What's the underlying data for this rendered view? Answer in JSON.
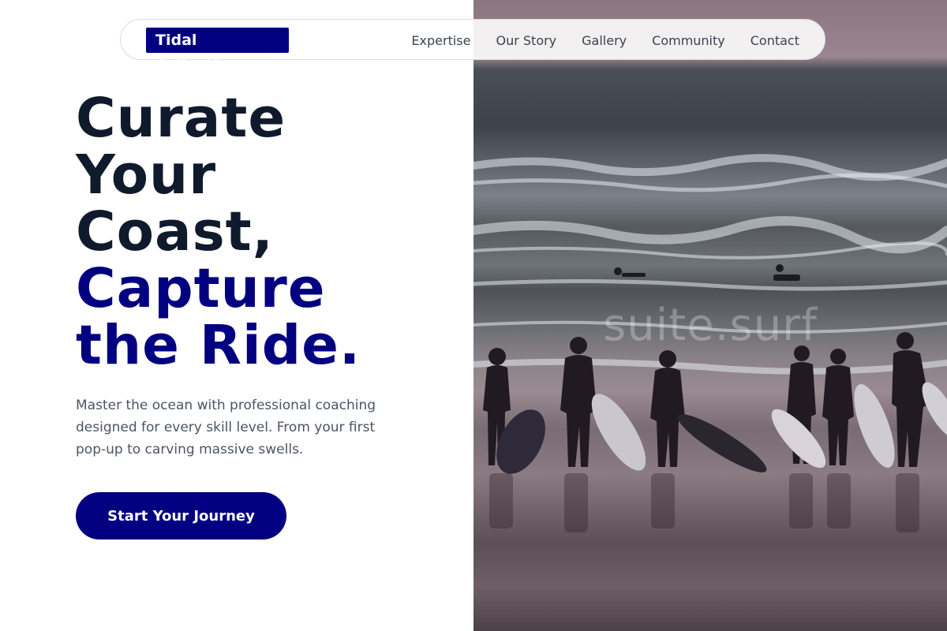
{
  "nav": {
    "brand": "Tidal Collective",
    "links": [
      "Expertise",
      "Our Story",
      "Gallery",
      "Community",
      "Contact"
    ]
  },
  "hero": {
    "headline_lines": [
      "Curate",
      "Your",
      "Coast,"
    ],
    "headline_accent_lines": [
      "Capture",
      "the Ride."
    ],
    "description": "Master the ocean with professional coaching designed for every skill level. From your first pop-up to carving massive swells.",
    "cta_label": "Start Your Journey",
    "watermark": "suite.surf"
  },
  "colors": {
    "brand_navy": "#020080",
    "heading_dark": "#0f1a2c",
    "body_text": "#4b5563",
    "nav_text": "#3b4451"
  }
}
